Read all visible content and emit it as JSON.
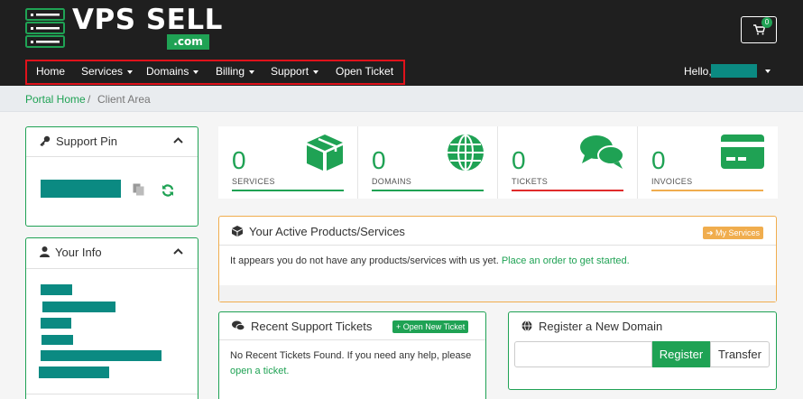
{
  "brand": {
    "name": "VPS SELL",
    "tld": ".com"
  },
  "cart": {
    "count": "0"
  },
  "nav": {
    "items": [
      {
        "label": "Home",
        "dropdown": false
      },
      {
        "label": "Services",
        "dropdown": true
      },
      {
        "label": "Domains",
        "dropdown": true
      },
      {
        "label": "Billing",
        "dropdown": true
      },
      {
        "label": "Support",
        "dropdown": true
      },
      {
        "label": "Open Ticket",
        "dropdown": false
      }
    ],
    "hello": "Hello,"
  },
  "breadcrumb": {
    "home": "Portal Home",
    "separator": "/",
    "current": "Client Area"
  },
  "sidebar": {
    "support_pin": {
      "title": "Support Pin"
    },
    "your_info": {
      "title": "Your Info"
    }
  },
  "stats": [
    {
      "value": "0",
      "label": "SERVICES",
      "icon": "cube-icon",
      "color": "#1fa254"
    },
    {
      "value": "0",
      "label": "DOMAINS",
      "icon": "globe-icon",
      "color": "#1fa254"
    },
    {
      "value": "0",
      "label": "TICKETS",
      "icon": "comments-icon",
      "color": "#e02b2b"
    },
    {
      "value": "0",
      "label": "INVOICES",
      "icon": "credit-card-icon",
      "color": "#f0ad4e"
    }
  ],
  "products": {
    "title": "Your Active Products/Services",
    "button": "➔ My Services",
    "message": "It appears you do not have any products/services with us yet.",
    "link": "Place an order to get started."
  },
  "tickets": {
    "title": "Recent Support Tickets",
    "button": "+ Open New Ticket",
    "message": "No Recent Tickets Found. If you need any help, please",
    "link": "open a ticket."
  },
  "domain_register": {
    "title": "Register a New Domain",
    "input_value": "",
    "register": "Register",
    "transfer": "Transfer"
  },
  "colors": {
    "accent": "#1fa254",
    "header": "#1f1f1f",
    "nav_highlight": "#e0121b",
    "redaction": "#0b8a82"
  }
}
